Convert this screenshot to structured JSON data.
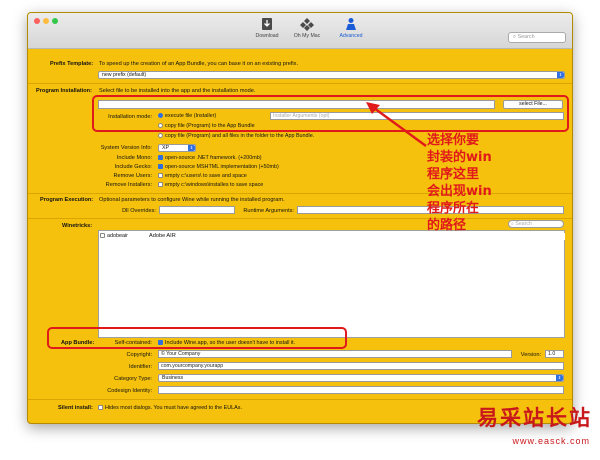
{
  "toolbar": {
    "download": "Download",
    "ohmymac": "Oh My Mac",
    "advanced": "Advanced",
    "search_placeholder": "Search"
  },
  "prefix": {
    "label": "Prefix Template:",
    "desc": "To speed up the creation of an App Bundle, you can base it on an existing prefix.",
    "value": "new prefix (default)"
  },
  "program_install": {
    "label": "Program Installation:",
    "desc": "Select file to be installed into the app and the installation mode.",
    "path_value": "",
    "select_button": "select File...",
    "mode_label": "Installation mode:",
    "mode_options": [
      "execute file (Installer)",
      "copy file (Program) to the App Bundle",
      "copy file (Program) and all files in the folder to the App Bundle."
    ],
    "args_placeholder": "Installer Arguments (opt)"
  },
  "settings": {
    "system_version_label": "System Version Info:",
    "system_version_value": "XP",
    "mono_label": "Include Mono:",
    "mono_text": "open-source .NET framework. (+200mb)",
    "gecko_label": "Include Gecko:",
    "gecko_text": "open-source MSHTML implementation (+50mb)",
    "remove_users_label": "Remove Users:",
    "remove_users_text": "empty c:\\users\\ to save and space",
    "remove_installers_label": "Remove Installers:",
    "remove_installers_text": "empty c:\\windows\\installes to save space"
  },
  "program_exec": {
    "label": "Program Execution:",
    "desc": "Optional parameters to configure Wine while running the installed program.",
    "dll_label": "Dll Overrides:",
    "runtime_label": "Runtime Arguments:"
  },
  "winetricks": {
    "label": "Winetricks:",
    "search_placeholder": "Search",
    "items": [
      {
        "name": "adobeair",
        "desc": "Adobe AIR"
      }
    ]
  },
  "app_bundle": {
    "label": "App Bundle:",
    "self_contained_label": "Self-contained:",
    "self_contained_text": "Include Wine.app, so the user doesn't have to install it.",
    "copyright_label": "Copyright:",
    "copyright_value": "© Your Company",
    "version_label": "Version:",
    "version_value": "1.0",
    "identifier_label": "Identifier:",
    "identifier_value": "com.yourcompany.yourapp",
    "category_label": "Category Type:",
    "category_value": "Business",
    "codesign_label": "Codesign Identity:",
    "codesign_value": ""
  },
  "silent": {
    "label": "Silent install:",
    "text": "Hides most dialogs. You must have agreed to the EULAs."
  },
  "annotation": {
    "lines": [
      "选择你要",
      "封装的win",
      "程序这里",
      "会出现win",
      "程序所在",
      "的路径"
    ]
  },
  "watermark": {
    "title": "易采站长站",
    "url": "www.easck.com"
  },
  "colors": {
    "background": "#f6c10c",
    "highlight": "#e0191b",
    "accent": "#2f6fe0"
  }
}
